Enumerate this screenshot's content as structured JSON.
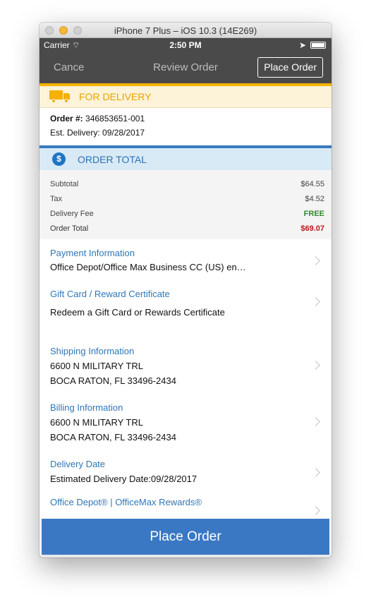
{
  "window": {
    "title": "iPhone 7 Plus – iOS 10.3 (14E269)"
  },
  "status_bar": {
    "carrier": "Carrier",
    "time": "2:50 PM"
  },
  "nav": {
    "cancel": "Cance",
    "title": "Review Order",
    "place_order": "Place Order"
  },
  "delivery": {
    "header": "FOR DELIVERY",
    "order_label": "Order #:",
    "order_number": "346853651-001",
    "est_delivery": "Est. Delivery: 09/28/2017"
  },
  "order_total": {
    "header": "ORDER TOTAL",
    "rows": [
      {
        "label": "Subtotal",
        "value": "$64.55"
      },
      {
        "label": "Tax",
        "value": "$4.52"
      },
      {
        "label": "Delivery Fee",
        "value": "FREE"
      },
      {
        "label": "Order Total",
        "value": "$69.07"
      }
    ]
  },
  "sections": {
    "payment": {
      "title": "Payment Information",
      "line1": "Office Depot/Office Max Business CC (US) en…"
    },
    "gift": {
      "title": "Gift Card / Reward Certificate",
      "line1": "Redeem a Gift Card or Rewards Certificate"
    },
    "shipping": {
      "title": "Shipping Information",
      "line1": "6600 N MILITARY TRL",
      "line2": "BOCA RATON, FL 33496-2434"
    },
    "billing": {
      "title": "Billing Information",
      "line1": "6600 N MILITARY TRL",
      "line2": "BOCA RATON, FL 33496-2434"
    },
    "delivery_date": {
      "title": "Delivery Date",
      "line1": "Estimated Delivery Date:09/28/2017"
    },
    "rewards": {
      "title": "Office Depot® | OfficeMax Rewards®"
    }
  },
  "place_order_button": "Place Order",
  "colors": {
    "accent": "#f5b100",
    "brand_blue": "#3a78c3",
    "free_green": "#2e8b2e",
    "total_red": "#c0161b"
  }
}
